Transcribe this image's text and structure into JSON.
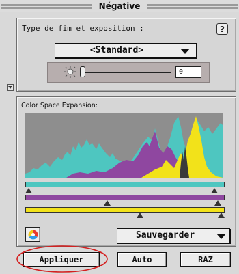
{
  "window": {
    "title": "Négative"
  },
  "film_section": {
    "label": "Type de fim et exposition :",
    "help_icon": "question-mark-icon",
    "film_type_selected": "<Standard>",
    "exposure_icon": "sun-icon",
    "exposure_value": "0"
  },
  "collapse_icon": "triangle-down-icon",
  "expansion_section": {
    "label": "Color Space Expansion:",
    "colors": {
      "cyan": "#4ec6c0",
      "magenta": "#8f47a0",
      "yellow": "#f2e21a",
      "histogram_bg": "#8e8e8e"
    },
    "slider_tracks": [
      "cyan-track",
      "magenta-track",
      "yellow-track"
    ],
    "color_wheel_icon": "color-wheel-icon",
    "save_menu_label": "Sauvegarder"
  },
  "buttons": {
    "apply": "Appliquer",
    "auto": "Auto",
    "reset": "RAZ"
  },
  "annotation": {
    "color": "#d42020"
  }
}
